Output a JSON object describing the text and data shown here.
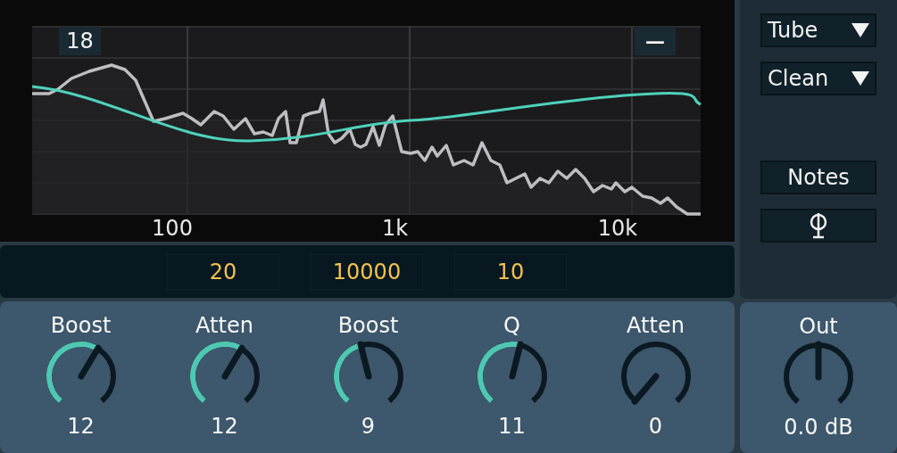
{
  "display": {
    "badge": "18",
    "collapse_button": "—",
    "freq_labels": [
      "100",
      "1k",
      "10k"
    ]
  },
  "value_fields": [
    {
      "value": "20"
    },
    {
      "value": "10000"
    },
    {
      "value": "10"
    }
  ],
  "knobs": [
    {
      "label": "Boost",
      "value": "12"
    },
    {
      "label": "Atten",
      "value": "12"
    },
    {
      "label": "Boost",
      "value": "9"
    },
    {
      "label": "Q",
      "value": "11"
    },
    {
      "label": "Atten",
      "value": "0"
    }
  ],
  "sidebar": {
    "dropdowns": [
      {
        "value": "Tube"
      },
      {
        "value": "Clean"
      }
    ],
    "buttons": [
      {
        "kind": "text",
        "label": "Notes"
      },
      {
        "kind": "phase"
      }
    ]
  },
  "output": {
    "label": "Out",
    "value": "0.0 dB"
  }
}
